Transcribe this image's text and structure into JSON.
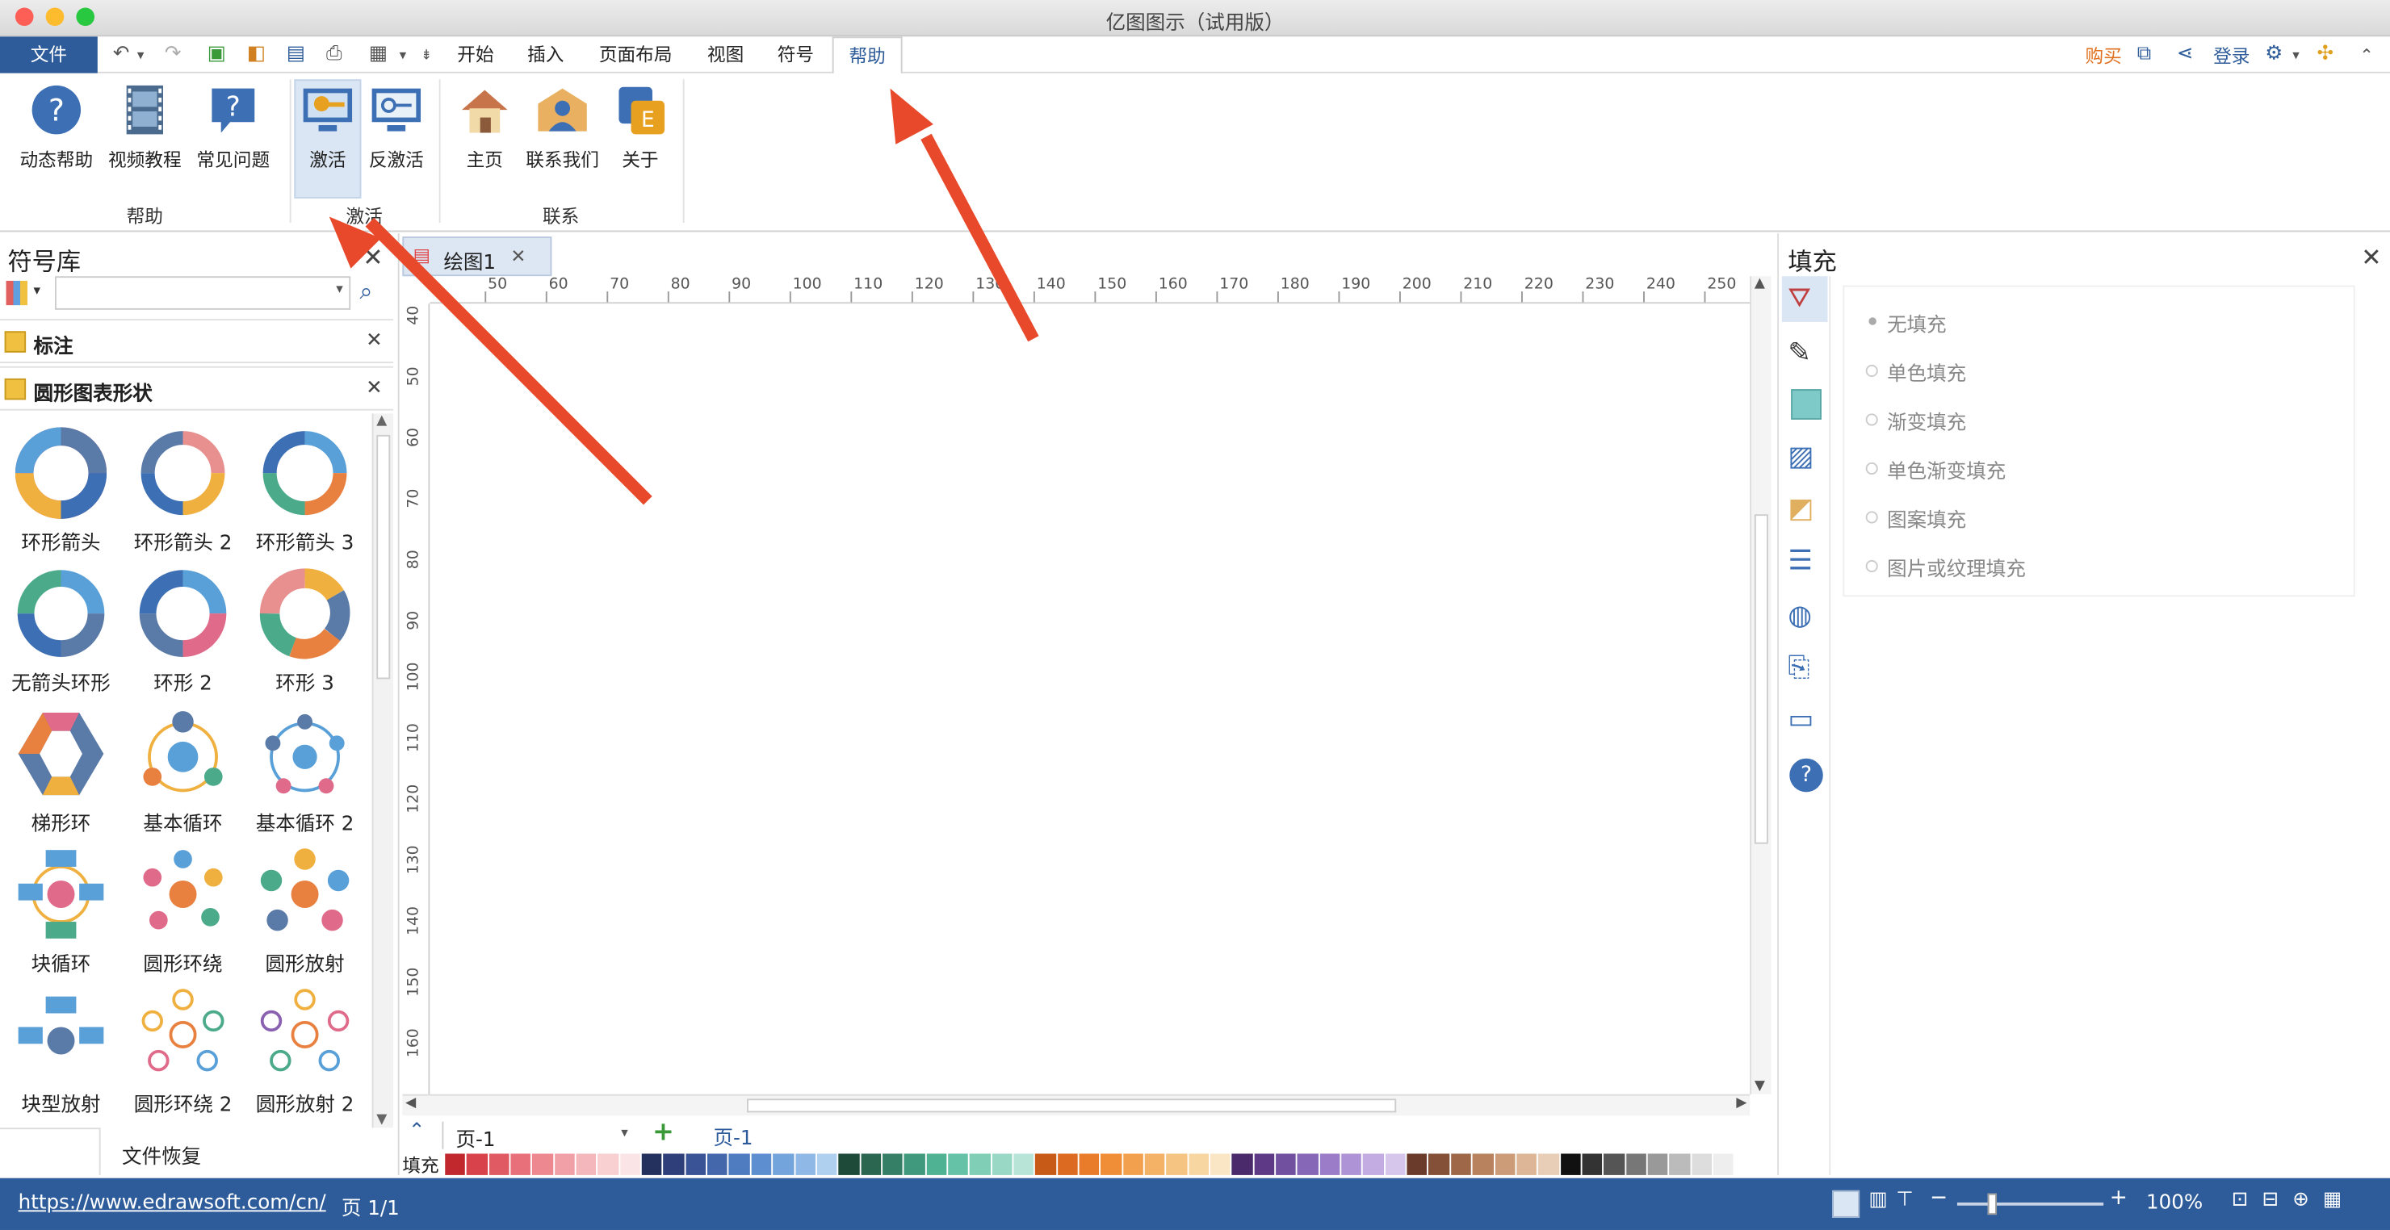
{
  "window": {
    "title": "亿图图示（试用版）"
  },
  "menu": {
    "file": "文件",
    "tabs": [
      "开始",
      "插入",
      "页面布局",
      "视图",
      "符号",
      "帮助"
    ],
    "active_tab": "帮助",
    "right": {
      "buy": "购买",
      "login": "登录"
    }
  },
  "ribbon": {
    "groups": [
      {
        "label": "帮助",
        "buttons": [
          "动态帮助",
          "视频教程",
          "常见问题"
        ]
      },
      {
        "label": "激活",
        "buttons": [
          "激活",
          "反激活"
        ]
      },
      {
        "label": "联系",
        "buttons": [
          "主页",
          "联系我们",
          "关于"
        ]
      }
    ]
  },
  "library": {
    "title": "符号库",
    "search_placeholder": "",
    "sections": [
      "标注",
      "圆形图表形状"
    ],
    "shapes": [
      "环形箭头",
      "环形箭头 2",
      "环形箭头 3",
      "无箭头环形",
      "环形 2",
      "环形 3",
      "梯形环",
      "基本循环",
      "基本循环 2",
      "块循环",
      "圆形环绕",
      "圆形放射",
      "块型放射",
      "圆形环绕 2",
      "圆形放射 2"
    ],
    "recovery": "文件恢复"
  },
  "canvas": {
    "doc_tab": "绘图1",
    "ruler_h": [
      "50",
      "60",
      "70",
      "80",
      "90",
      "100",
      "110",
      "120",
      "130",
      "140",
      "150",
      "160",
      "170",
      "180",
      "190",
      "200",
      "210",
      "220",
      "230",
      "240",
      "250"
    ],
    "ruler_v": [
      "40",
      "50",
      "60",
      "70",
      "80",
      "90",
      "100",
      "110",
      "120",
      "130",
      "140",
      "150",
      "160"
    ]
  },
  "pages": {
    "current": "页-1",
    "tab": "页-1"
  },
  "palette": {
    "label": "填充"
  },
  "fill_panel": {
    "title": "填充",
    "options": [
      "无填充",
      "单色填充",
      "渐变填充",
      "单色渐变填充",
      "图案填充",
      "图片或纹理填充"
    ]
  },
  "status": {
    "url": "https://www.edrawsoft.com/cn/",
    "page": "页 1/1",
    "zoom": "100%"
  },
  "colors": {
    "accent": "#2e5c9a",
    "arrow": "#e8492b"
  }
}
